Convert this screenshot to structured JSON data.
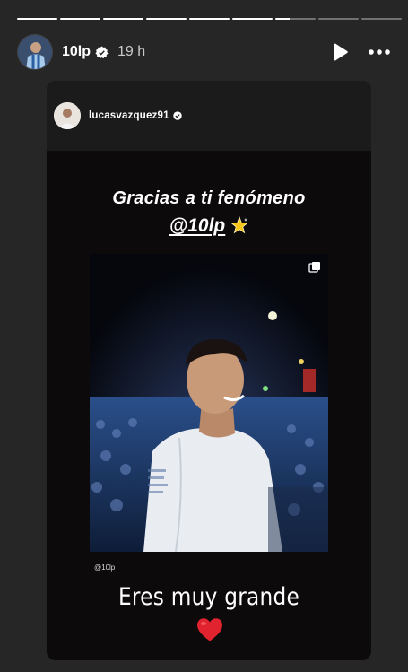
{
  "story": {
    "segments": [
      1,
      1,
      1,
      1,
      1,
      1,
      0.35,
      0,
      0
    ],
    "username": "10lp",
    "time": "19 h"
  },
  "icons": {
    "verified": "verified-badge-icon",
    "play": "play-icon",
    "more": "more-options-icon"
  },
  "repost": {
    "username": "lucasvazquez91",
    "line1": "Gracias a ti fenómeno",
    "mention": "@10lp",
    "emoji": "glowing-star",
    "credit": "@10lp",
    "line2": "Eres muy grande",
    "heart": "red-heart"
  },
  "colors": {
    "background": "#262626",
    "card": "#0c0a0a",
    "heart": "#e0232e",
    "star": "#f5c518"
  }
}
